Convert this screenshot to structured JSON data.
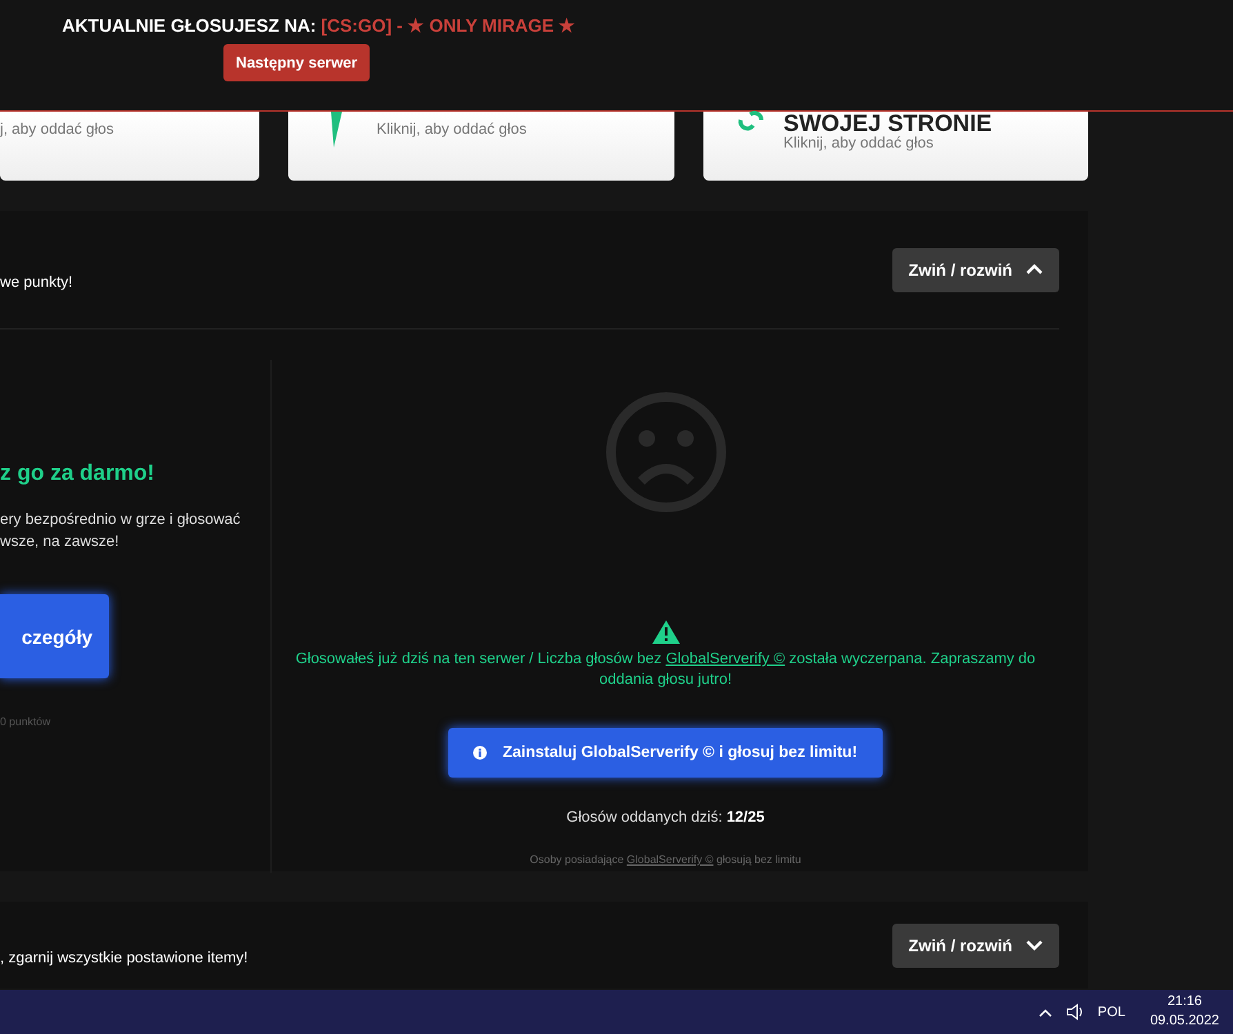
{
  "header": {
    "label": "AKTUALNIE GŁOSUJESZ NA:",
    "server": "[CS:GO] - ★ ONLY MIRAGE ★",
    "button": "Następny serwer"
  },
  "vote_cards": [
    {
      "subtitle": "j, aby oddać głos"
    },
    {
      "subtitle": "Kliknij, aby oddać głos"
    },
    {
      "title": "SWOJEJ STRONIE",
      "subtitle": "Kliknij, aby oddać głos"
    }
  ],
  "sections": [
    {
      "description": "we punkty!",
      "toggle": {
        "label": "Zwiń / rozwiń",
        "expanded": true
      },
      "promo": {
        "heading": "z go za darmo!",
        "text": [
          "ery bezpośrednio w grze i głosować",
          "wsze, na zawsze!"
        ],
        "button": "czegóły",
        "note": "0 punktów"
      },
      "status": {
        "message_before": "Głosowałeś już dziś na ten serwer / Liczba głosów bez ",
        "message_link": "GlobalServerify ©",
        "message_after": " została wyczerpana. Zapraszamy do oddania głosu jutro!",
        "install_button": "Zainstaluj GlobalServerify © i głosuj bez limitu!",
        "votes_label": "Głosów oddanych dziś:",
        "votes_value": "12/25",
        "footnote_before": "Osoby posiadające ",
        "footnote_link": "GlobalServerify ©",
        "footnote_after": " głosują bez limitu"
      }
    },
    {
      "description": ", zgarnij wszystkie postawione itemy!",
      "toggle": {
        "label": "Zwiń / rozwiń",
        "expanded": false
      }
    }
  ],
  "taskbar": {
    "language": "POL",
    "time": "21:16",
    "date": "09.05.2022"
  }
}
